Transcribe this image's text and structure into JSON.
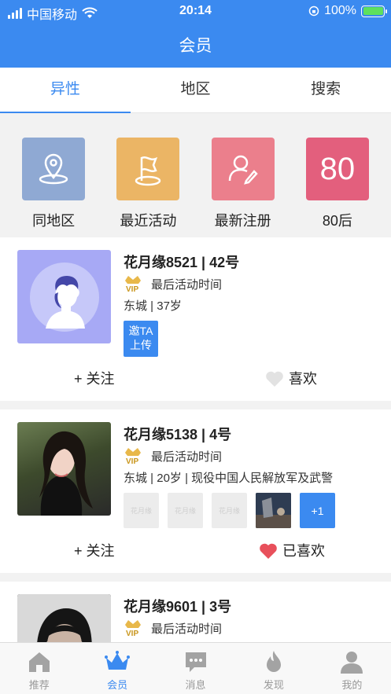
{
  "status": {
    "carrier": "中国移动",
    "time": "20:14",
    "battery": "100%"
  },
  "header": {
    "title": "会员"
  },
  "tabs": [
    {
      "label": "异性",
      "active": true
    },
    {
      "label": "地区",
      "active": false
    },
    {
      "label": "搜索",
      "active": false
    }
  ],
  "categories": [
    {
      "label": "同地区",
      "icon": "location-icon",
      "color": "#8fa9d3"
    },
    {
      "label": "最近活动",
      "icon": "flag-icon",
      "color": "#ebb565"
    },
    {
      "label": "最新注册",
      "icon": "user-edit-icon",
      "color": "#eb7f8c"
    },
    {
      "label": "80后",
      "number": "80",
      "color": "#e35f7d"
    }
  ],
  "members": [
    {
      "name": "花月缘8521 | 42号",
      "activity": "最后活动时间",
      "info": "东城 | 37岁",
      "invite": [
        "邀TA",
        "上传"
      ],
      "follow": "+ 关注",
      "like": "喜欢",
      "liked": false
    },
    {
      "name": "花月缘5138 | 4号",
      "activity": "最后活动时间",
      "info": "东城 | 20岁 | 现役中国人民解放军及武警",
      "thumbs": [
        "花月缘",
        "花月缘",
        "花月缘"
      ],
      "more": "+1",
      "follow": "+ 关注",
      "like": "已喜欢",
      "liked": true
    },
    {
      "name": "花月缘9601 | 3号",
      "activity": "最后活动时间"
    }
  ],
  "nav": [
    {
      "label": "推荐",
      "icon": "home-icon",
      "active": false
    },
    {
      "label": "会员",
      "icon": "crown-icon",
      "active": true
    },
    {
      "label": "消息",
      "icon": "message-icon",
      "active": false
    },
    {
      "label": "发现",
      "icon": "flame-icon",
      "active": false
    },
    {
      "label": "我的",
      "icon": "person-icon",
      "active": false
    }
  ],
  "colors": {
    "brand": "#3b8af0",
    "like": "#e8505b"
  }
}
